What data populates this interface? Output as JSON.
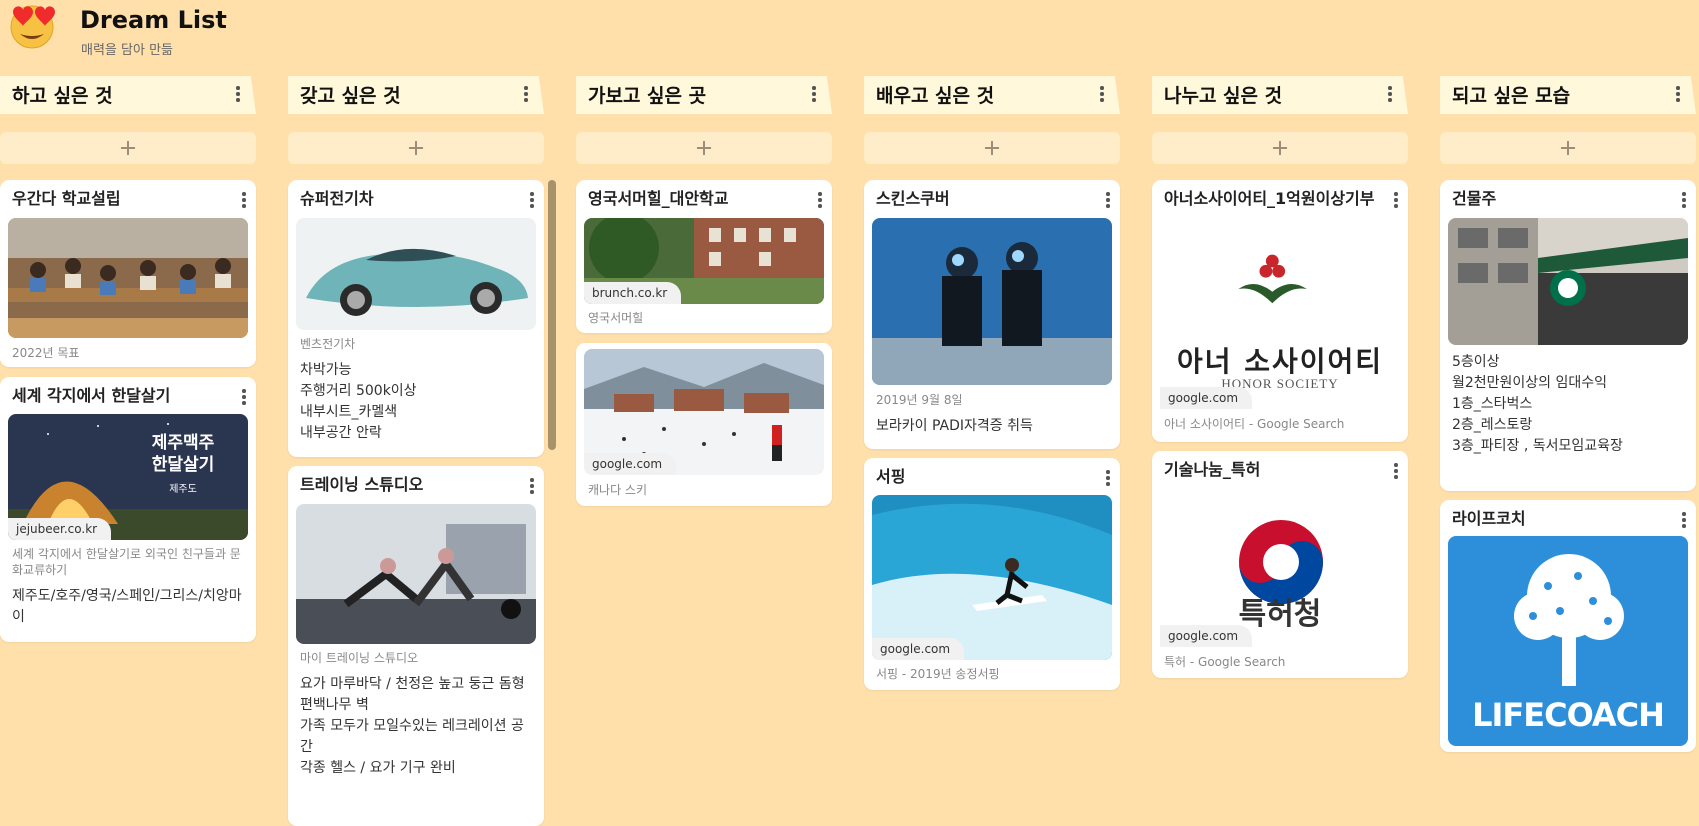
{
  "board": {
    "emoji": "😍",
    "title": "Dream List",
    "subtitle": "매력을 담아 만듦"
  },
  "columns": [
    {
      "title": "하고 싶은 것"
    },
    {
      "title": "갖고 싶은 것"
    },
    {
      "title": "가보고 싶은 곳"
    },
    {
      "title": "배우고 싶은 것"
    },
    {
      "title": "나누고 싶은 것"
    },
    {
      "title": "되고 싶은 모습"
    }
  ],
  "cards": {
    "c1a": {
      "title": "우간다 학교설립",
      "meta": "2022년 목표"
    },
    "c1b": {
      "title": "세계 각지에서 한달살기",
      "image_text": "제주맥주\n한달살기",
      "image_sub": "제주도",
      "domain": "jejubeer.co.kr",
      "meta": "세계 각지에서 한달살기로 외국인 친구들과 문화교류하기",
      "body": "제주도/호주/영국/스페인/그리스/치앙마이"
    },
    "c2a": {
      "title": "슈퍼전기차",
      "meta": "벤츠전기차",
      "body": "차박가능\n주행거리 500k이상\n내부시트_카멜색\n내부공간 안락"
    },
    "c2b": {
      "title": "트레이닝 스튜디오",
      "meta": "마이 트레이닝 스튜디오",
      "body": "요가 마루바닥 / 천정은 높고 둥근 돔형\n편백나무 벽\n가족 모두가 모일수있는 레크레이션 공간\n각종 헬스 / 요가 기구 완비"
    },
    "c3a": {
      "title": "영국서머힐_대안학교",
      "domain": "brunch.co.kr",
      "meta": "영국서머힐"
    },
    "c3b": {
      "domain": "google.com",
      "meta": "캐나다 스키"
    },
    "c4a": {
      "title": "스킨스쿠버",
      "meta": "2019년 9월 8일",
      "body": "보라카이 PADI자격증 취득"
    },
    "c4b": {
      "title": "서핑",
      "domain": "google.com",
      "meta": "서핑 - 2019년 송정서핑"
    },
    "c5a": {
      "title": "아너소사이어티_1억원이상기부",
      "logo_text": "아너 소사이어티",
      "logo_sub": "HONOR SOCIETY",
      "domain": "google.com",
      "meta": "아너 소사이어티 - Google Search"
    },
    "c5b": {
      "title": "기술나눔_특허",
      "logo_text": "특허청",
      "domain": "google.com",
      "meta": "특허 - Google Search"
    },
    "c6a": {
      "title": "건물주",
      "body": "5층이상\n월2천만원이상의 임대수익\n1층_스타벅스\n2층_레스토랑\n3층_파티장 , 독서모임교육장"
    },
    "c6b": {
      "title": "라이프코치",
      "logo_text": "LIFECOACH"
    }
  },
  "colors": {
    "background": "#ffdfaa",
    "column_header": "#fff8db",
    "add_button": "#ffecc8"
  }
}
